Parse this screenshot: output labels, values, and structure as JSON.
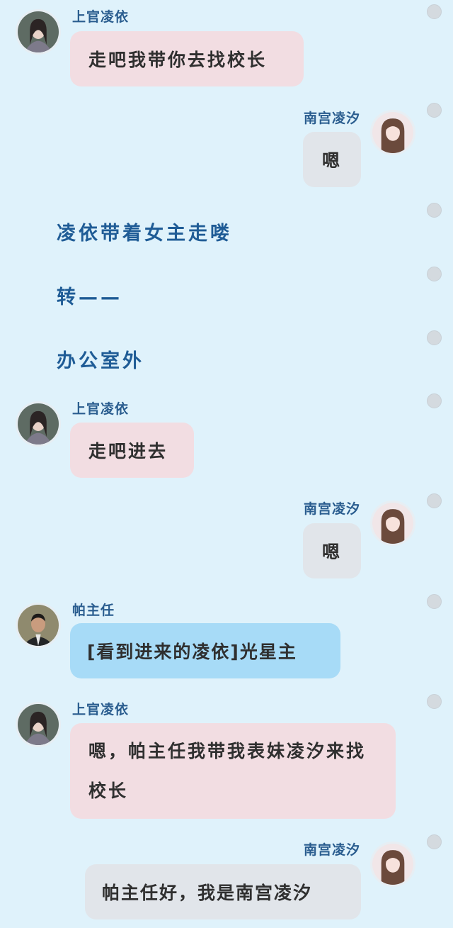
{
  "characters": {
    "lingyi": {
      "name": "上官凌依"
    },
    "lingxi": {
      "name": "南宫凌汐"
    },
    "pa": {
      "name": "帕主任"
    }
  },
  "messages": [
    {
      "speaker": "上官凌依",
      "text": "走吧我带你去找校长"
    },
    {
      "speaker": "南宫凌汐",
      "text": "嗯"
    },
    {
      "narration": "凌依带着女主走喽"
    },
    {
      "narration": "转——"
    },
    {
      "narration": "办公室外"
    },
    {
      "speaker": "上官凌依",
      "text": "走吧进去"
    },
    {
      "speaker": "南宫凌汐",
      "text": "嗯"
    },
    {
      "speaker": "帕主任",
      "text": "[看到进来的凌依]光星主"
    },
    {
      "speaker": "上官凌依",
      "text": "嗯，帕主任我带我表妹凌汐来找校长"
    },
    {
      "speaker": "南宫凌汐",
      "text": "帕主任好，我是南宫凌汐"
    }
  ],
  "colors": {
    "background": "#dff2fb",
    "bubble_lingyi": "#f2dde2",
    "bubble_lingxi": "#e1e5ea",
    "bubble_pa": "#a7dbf7",
    "name_text": "#2a5d8f",
    "narration_text": "#1f5c96"
  }
}
